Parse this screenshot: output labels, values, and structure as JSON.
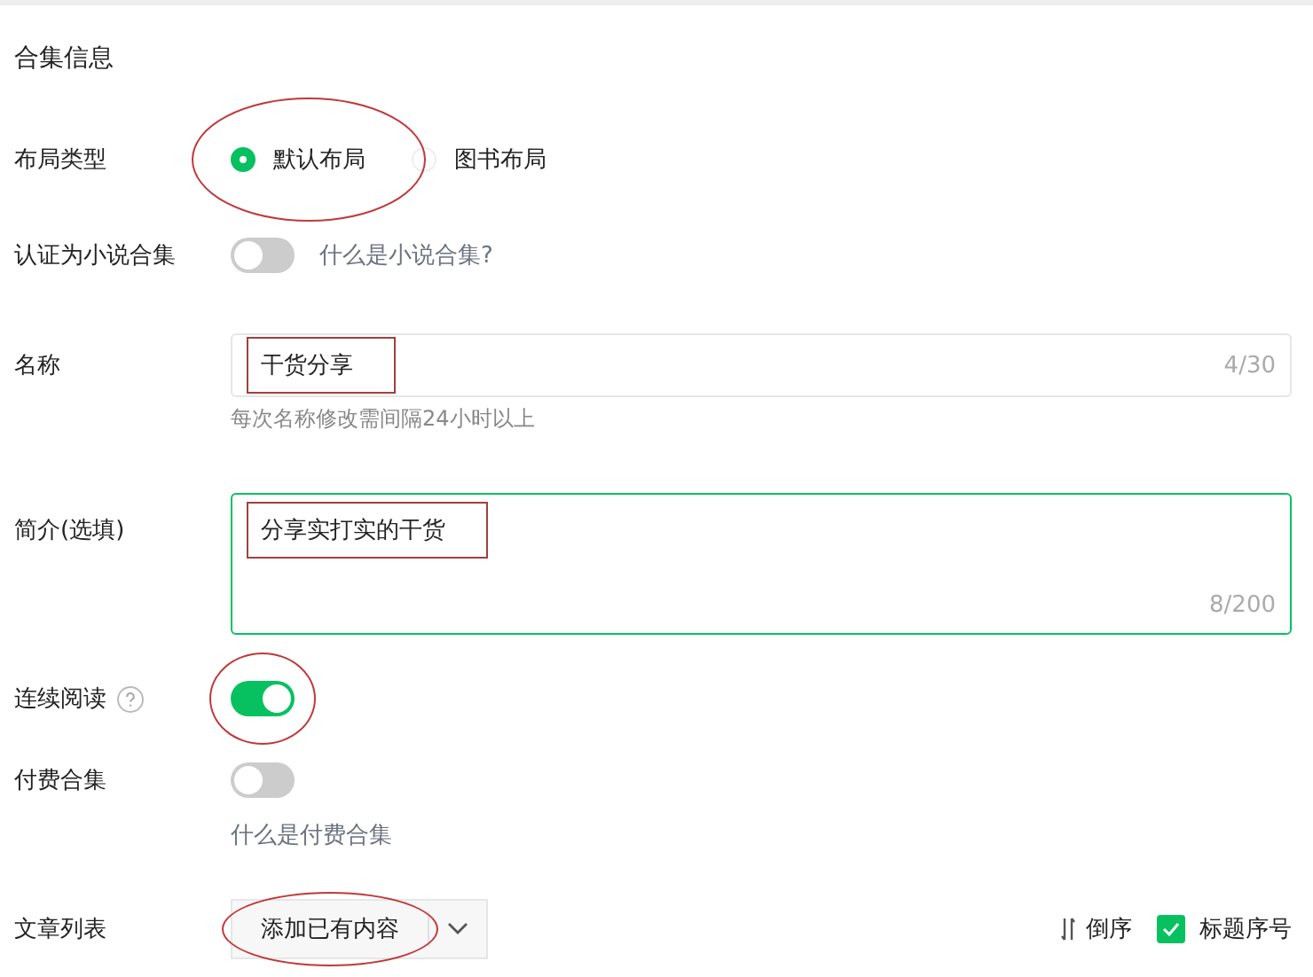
{
  "title": "合集信息",
  "layout": {
    "label": "布局类型",
    "circled": true,
    "options": [
      {
        "label": "默认布局",
        "selected": true
      },
      {
        "label": "图书布局",
        "selected": false
      }
    ]
  },
  "novel": {
    "label": "认证为小说合集",
    "on": false,
    "link": "什么是小说合集?"
  },
  "name": {
    "label": "名称",
    "value": "干货分享",
    "counter": "4/30",
    "hint": "每次名称修改需间隔24小时以上",
    "boxed": true,
    "focused": false
  },
  "intro": {
    "label": "简介(选填)",
    "value": "分享实打实的干货",
    "counter": "8/200",
    "boxed": true,
    "focused": true
  },
  "continuous": {
    "label": "连续阅读",
    "on": true,
    "circled": true
  },
  "paid": {
    "label": "付费合集",
    "on": false,
    "link": "什么是付费合集"
  },
  "articles": {
    "label": "文章列表",
    "button": "添加已有内容",
    "circled": true,
    "reverse": "倒序",
    "title_numbers": {
      "label": "标题序号",
      "checked": true
    }
  }
}
